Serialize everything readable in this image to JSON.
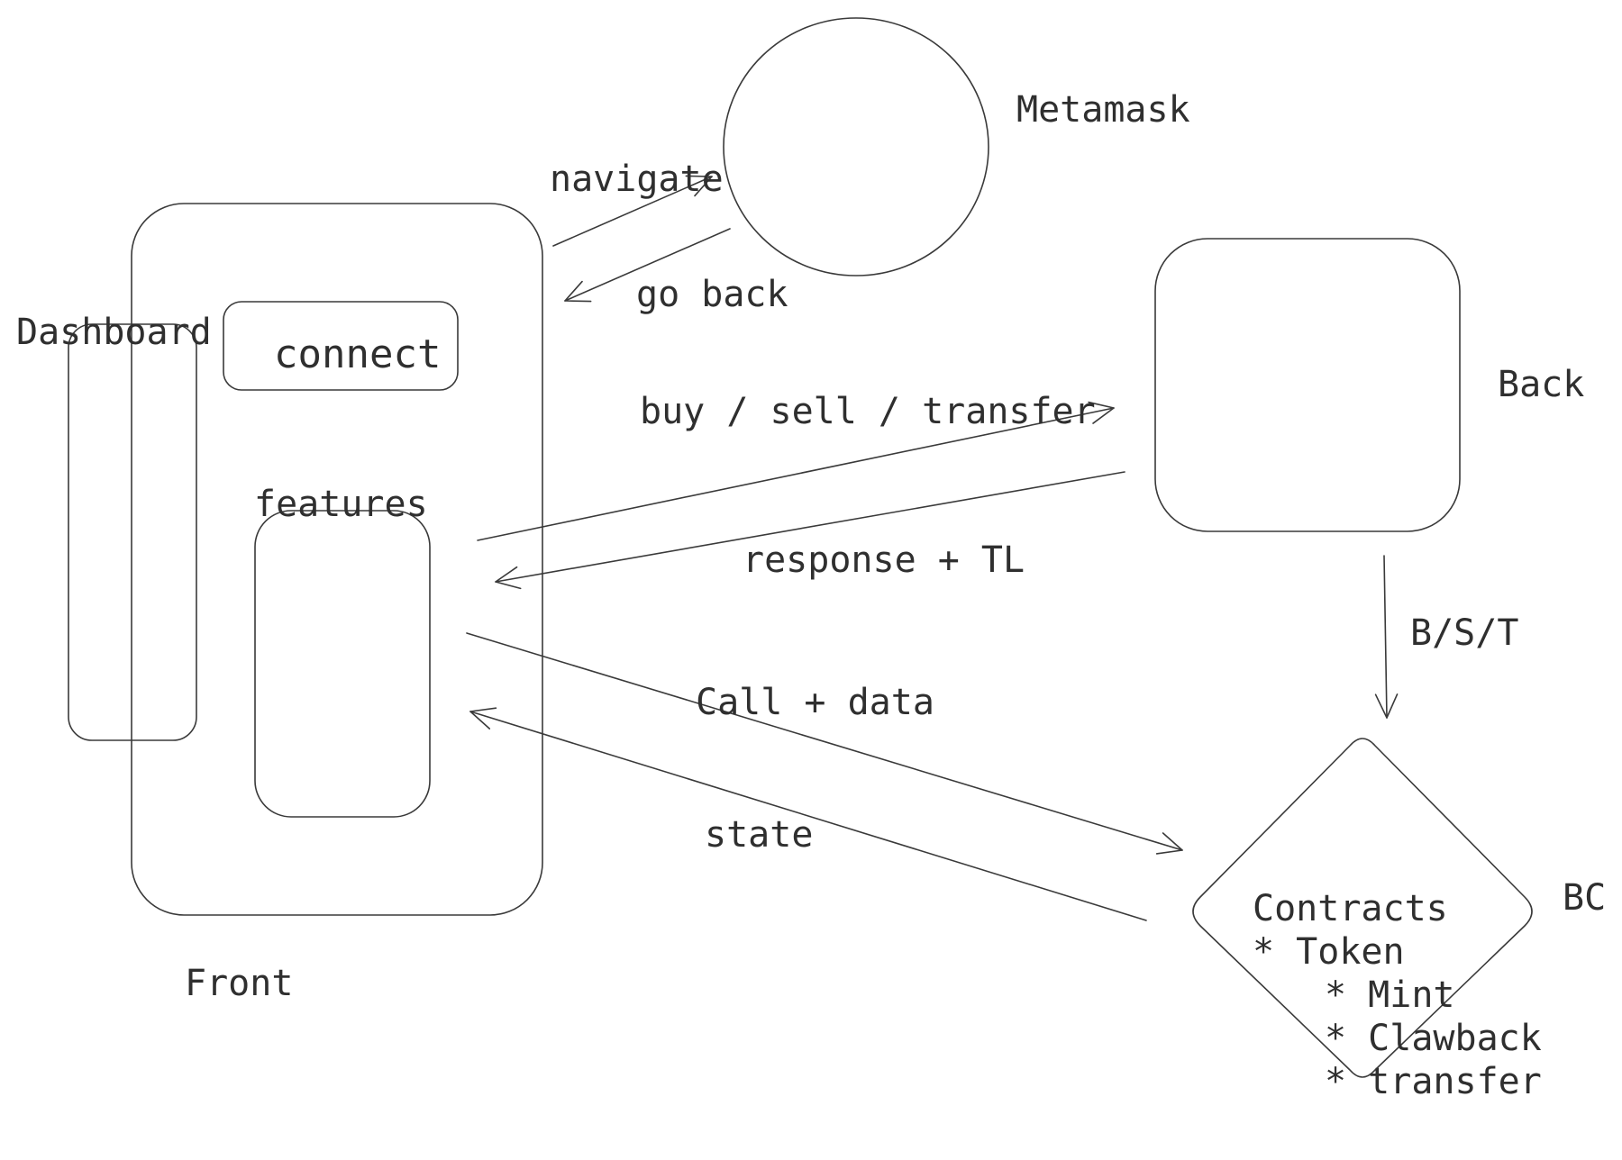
{
  "nodes": {
    "front": "Front",
    "dashboard": "Dashboard",
    "connect": "connect",
    "features": "features",
    "metamask": "Metamask",
    "back": "Back",
    "bc": "BC",
    "contracts": {
      "title": "Contracts",
      "items": [
        "* Token",
        "* Mint",
        "* Clawback",
        "* transfer"
      ]
    }
  },
  "edges": {
    "navigate": "navigate",
    "go_back": "go back",
    "buy_sell_transfer": "buy / sell / transfer",
    "response_tl": "response + TL",
    "bst": "B/S/T",
    "call_data": "Call + data",
    "state": "state"
  }
}
